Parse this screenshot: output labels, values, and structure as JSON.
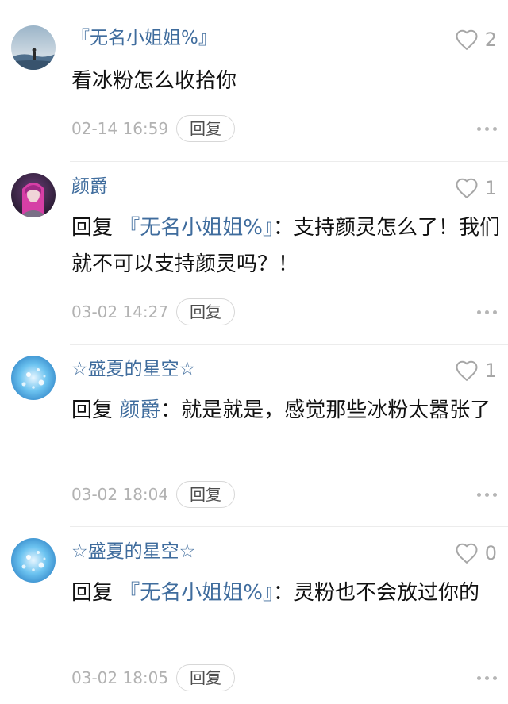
{
  "comments": [
    {
      "username": "『无名小姐姐%』",
      "likes": "2",
      "text": "看冰粉怎么收拾你",
      "time": "02-14 16:59",
      "reply_label": "回复"
    },
    {
      "username": "颜爵",
      "likes": "1",
      "reply_prefix": "回复 ",
      "mention": "『无名小姐姐%』",
      "text": "：支持颜灵怎么了！我们就不可以支持颜灵吗？！",
      "time": "03-02 14:27",
      "reply_label": "回复"
    },
    {
      "username": "☆盛夏的星空☆",
      "likes": "1",
      "reply_prefix": "回复 ",
      "mention": "颜爵",
      "text": "：就是就是，感觉那些冰粉太嚣张了",
      "time": "03-02 18:04",
      "reply_label": "回复"
    },
    {
      "username": "☆盛夏的星空☆",
      "likes": "0",
      "reply_prefix": "回复 ",
      "mention": "『无名小姐姐%』",
      "text": "：灵粉也不会放过你的",
      "time": "03-02 18:05",
      "reply_label": "回复"
    }
  ],
  "icons": {
    "like": "heart-outline-icon",
    "more": "more-dots-icon"
  },
  "colors": {
    "username": "#3f6c9d",
    "text": "#111111",
    "meta": "#b2b2b2",
    "divider": "#ececec"
  }
}
